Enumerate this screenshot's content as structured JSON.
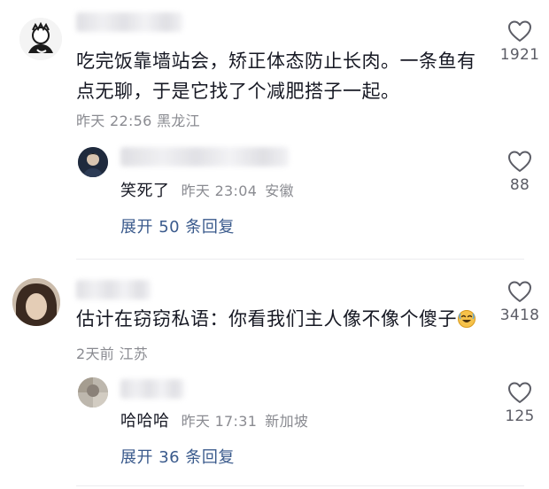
{
  "comments": [
    {
      "text": "吃完饭靠墙站会，矫正体态防止长肉。一条鱼有点无聊，于是它找了个减肥搭子一起。",
      "time": "昨天 22:56",
      "location": "黑龙江",
      "likes": "1921",
      "reply": {
        "text": "笑死了",
        "time": "昨天 23:04",
        "location": "安徽",
        "likes": "88"
      },
      "expand_label": "展开 50 条回复"
    },
    {
      "text": "估计在窃窃私语：你看我们主人像不像个傻子",
      "emoji": "laughing-emoji-icon",
      "time": "2天前",
      "location": "江苏",
      "likes": "3418",
      "reply": {
        "text": "哈哈哈",
        "time": "昨天 17:31",
        "location": "新加坡",
        "likes": "125"
      },
      "expand_label": "展开 36 条回复"
    }
  ],
  "colors": {
    "text": "#161823",
    "meta": "#8a8b91",
    "link": "#3a5a8c"
  }
}
